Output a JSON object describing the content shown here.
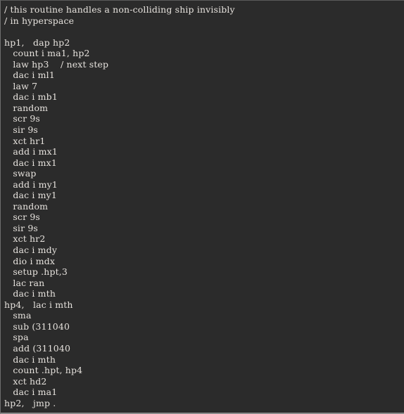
{
  "viewer": {
    "background_color": "#2b2b2b",
    "text_color": "#e6e2dd",
    "border_color": "#8a8a8a",
    "language": "PDP-1 assembly"
  },
  "code": {
    "line_count": 35,
    "lines": [
      "/ this routine handles a non-colliding ship invisibly",
      "/ in hyperspace",
      "",
      "hp1,   dap hp2",
      "   count i ma1, hp2",
      "   law hp3    / next step",
      "   dac i ml1",
      "   law 7",
      "   dac i mb1",
      "   random",
      "   scr 9s",
      "   sir 9s",
      "   xct hr1",
      "   add i mx1",
      "   dac i mx1",
      "   swap",
      "   add i my1",
      "   dac i my1",
      "   random",
      "   scr 9s",
      "   sir 9s",
      "   xct hr2",
      "   dac i mdy",
      "   dio i mdx",
      "   setup .hpt,3",
      "   lac ran",
      "   dac i mth",
      "hp4,   lac i mth",
      "   sma",
      "   sub (311040",
      "   spa",
      "   add (311040",
      "   dac i mth",
      "   count .hpt, hp4",
      "   xct hd2",
      "   dac i ma1",
      "hp2,   jmp ."
    ]
  }
}
